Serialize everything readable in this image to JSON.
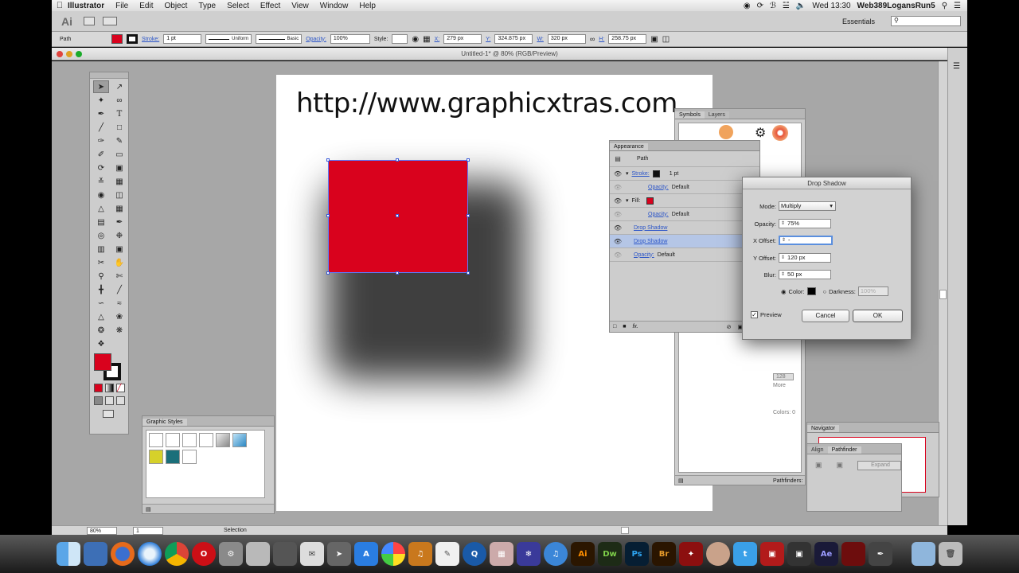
{
  "menubar": {
    "app_name": "Illustrator",
    "items": [
      "File",
      "Edit",
      "Object",
      "Type",
      "Select",
      "Effect",
      "View",
      "Window",
      "Help"
    ],
    "clock": "Wed 13:30",
    "user": "Web389LogansRun5"
  },
  "workspace": {
    "logo": "Ai",
    "name": "Essentials"
  },
  "control_bar": {
    "object_type": "Path",
    "stroke_label": "Stroke:",
    "stroke_weight": "1 pt",
    "profile": "Uniform",
    "brush": "Basic",
    "opacity_label": "Opacity:",
    "opacity": "100%",
    "style_label": "Style:",
    "x_label": "X:",
    "x": "279 px",
    "y_label": "Y:",
    "y": "324.875 px",
    "w_label": "W:",
    "w": "320 px",
    "h_label": "H:",
    "h": "258.75 px",
    "fill_color": "#d9021d"
  },
  "document": {
    "title": "Untitled-1* @ 80% (RGB/Preview)",
    "url_text": "http://www.graphicxtras.com"
  },
  "status_bar": {
    "zoom": "80%",
    "page": "1",
    "tool": "Selection"
  },
  "graphic_styles": {
    "title": "Graphic Styles"
  },
  "symbols_panel": {
    "tabs": [
      "Symbols",
      "Layers"
    ]
  },
  "appearance": {
    "title": "Appearance",
    "header": "Path",
    "rows": [
      {
        "label": "Stroke:",
        "value": "1 pt"
      },
      {
        "label": "Opacity:",
        "value": "Default"
      },
      {
        "label": "Fill:",
        "value": ""
      },
      {
        "label": "Opacity:",
        "value": "Default"
      },
      {
        "label": "Drop Shadow",
        "value": ""
      },
      {
        "label": "Drop Shadow",
        "value": ""
      },
      {
        "label": "Opacity:",
        "value": "Default"
      }
    ]
  },
  "color_panel": {
    "more": "More",
    "colors": "Colors: 0",
    "value": "128"
  },
  "navigator": {
    "title": "Navigator"
  },
  "pathfinder": {
    "tabs": [
      "Align",
      "Pathfinder"
    ],
    "expand": "Expand",
    "label": "Pathfinders:"
  },
  "drop_shadow": {
    "title": "Drop Shadow",
    "mode_label": "Mode:",
    "mode": "Multiply",
    "opacity_label": "Opacity:",
    "opacity": "75%",
    "x_label": "X Offset:",
    "x_offset": "-",
    "y_label": "Y Offset:",
    "y_offset": "120 px",
    "blur_label": "Blur:",
    "blur": "50 px",
    "color_label": "Color:",
    "darkness_label": "Darkness:",
    "darkness": "100%",
    "preview_label": "Preview",
    "cancel": "Cancel",
    "ok": "OK"
  },
  "dock": {
    "labels": [
      "Ai",
      "Dw",
      "Ps",
      "Br",
      "Ae"
    ]
  }
}
